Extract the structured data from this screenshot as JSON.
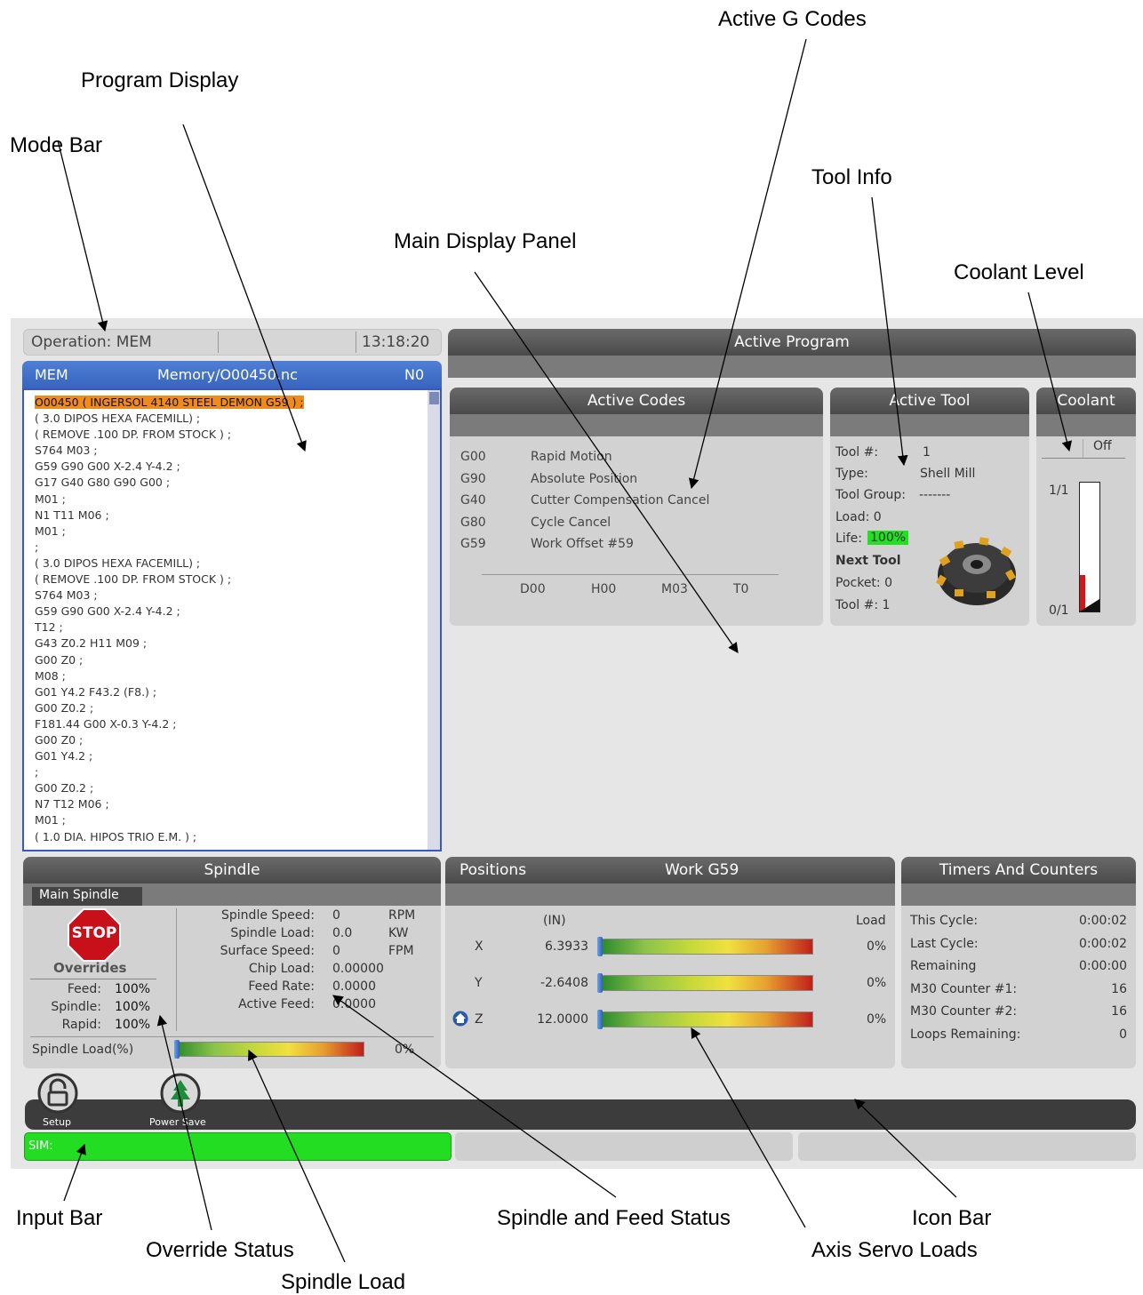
{
  "callouts": {
    "active_g_codes": "Active G Codes",
    "program_display": "Program Display",
    "mode_bar": "Mode Bar",
    "tool_info": "Tool Info",
    "main_display_panel": "Main Display Panel",
    "coolant_level": "Coolant Level",
    "input_bar": "Input Bar",
    "override_status": "Override Status",
    "spindle_load": "Spindle Load",
    "spindle_feed_status": "Spindle and Feed Status",
    "axis_servo_loads": "Axis Servo Loads",
    "icon_bar": "Icon Bar"
  },
  "mode_bar": {
    "operation": "Operation: MEM",
    "time": "13:18:20"
  },
  "program": {
    "mode": "MEM",
    "path": "Memory/O00450.nc",
    "n": "N0",
    "lines": [
      "O00450 ( INGERSOL 4140 STEEL DEMON G59 ) ;",
      "( 3.0 DIPOS HEXA FACEMILL) ;",
      "( REMOVE .100 DP. FROM STOCK ) ;",
      "S764 M03 ;",
      "G59 G90 G00 X-2.4 Y-4.2 ;",
      "G17 G40 G80 G90 G00 ;",
      "M01 ;",
      "N1 T11 M06 ;",
      "M01 ;",
      ";",
      "( 3.0 DIPOS HEXA FACEMILL) ;",
      "( REMOVE .100 DP. FROM STOCK ) ;",
      "S764 M03 ;",
      "G59 G90 G00 X-2.4 Y-4.2 ;",
      "T12 ;",
      "G43 Z0.2 H11 M09 ;",
      "G00 Z0 ;",
      "M08 ;",
      "G01 Y4.2 F43.2 (F8.) ;",
      "G00 Z0.2 ;",
      "F181.44 G00 X-0.3 Y-4.2 ;",
      "G00 Z0 ;",
      "G01 Y4.2 ;",
      ";",
      "G00 Z0.2 ;",
      "N7 T12 M06 ;",
      "M01 ;",
      "( 1.0 DIA. HIPOS TRIO E.M. ) ;"
    ]
  },
  "active_program": {
    "title": "Active Program"
  },
  "active_codes": {
    "title": "Active Codes",
    "rows": [
      [
        "G00",
        "Rapid Motion"
      ],
      [
        "G90",
        "Absolute Position"
      ],
      [
        "G40",
        "Cutter Compensation Cancel"
      ],
      [
        "G80",
        "Cycle Cancel"
      ],
      [
        "G59",
        "Work Offset #59"
      ]
    ],
    "footer": [
      "D00",
      "H00",
      "M03",
      "T0"
    ]
  },
  "active_tool": {
    "title": "Active Tool",
    "tool_label": "Tool #:",
    "tool_value": "1",
    "type_label": "Type:",
    "type_value": "Shell Mill",
    "group_label": "Tool Group:",
    "group_value": "-------",
    "load": "Load: 0",
    "life_label": "Life:",
    "life_value": "100%",
    "next_tool": "Next Tool",
    "pocket": "Pocket: 0",
    "next_tool_num": "Tool #: 1"
  },
  "coolant": {
    "title": "Coolant",
    "status": "Off",
    "top_label": "1/1",
    "bottom_label": "0/1",
    "level": 0.28
  },
  "spindle": {
    "title": "Spindle",
    "tab": "Main Spindle",
    "stop": "STOP",
    "overrides_title": "Overrides",
    "overrides": [
      [
        "Feed:",
        "100%"
      ],
      [
        "Spindle:",
        "100%"
      ],
      [
        "Rapid:",
        "100%"
      ]
    ],
    "status": [
      [
        "Spindle Speed:",
        "0",
        "RPM"
      ],
      [
        "Spindle Load:",
        "0.0",
        "KW"
      ],
      [
        "Surface Speed:",
        "0",
        "FPM"
      ],
      [
        "Chip Load:",
        "0.00000",
        ""
      ],
      [
        "Feed Rate:",
        "0.0000",
        ""
      ],
      [
        "Active Feed:",
        "0.0000",
        ""
      ]
    ],
    "load_label": "Spindle Load(%)",
    "load_value": "0%",
    "load": 0
  },
  "positions": {
    "title": "Positions",
    "work": "Work G59",
    "unit": "(IN)",
    "load_header": "Load",
    "axes": [
      {
        "axis": "X",
        "value": "6.3933",
        "load": "0%"
      },
      {
        "axis": "Y",
        "value": "-2.6408",
        "load": "0%"
      },
      {
        "axis": "Z",
        "value": "12.0000",
        "load": "0%"
      }
    ]
  },
  "timers": {
    "title": "Timers And Counters",
    "rows": [
      [
        "This Cycle:",
        "0:00:02"
      ],
      [
        "Last Cycle:",
        "0:00:02"
      ],
      [
        "Remaining",
        "0:00:00"
      ],
      [
        "M30 Counter #1:",
        "16"
      ],
      [
        "M30 Counter #2:",
        "16"
      ],
      [
        "Loops Remaining:",
        "0"
      ]
    ]
  },
  "icons": {
    "setup": "Setup",
    "power_save": "Power Save"
  },
  "input_bar": {
    "text": "SIM:"
  }
}
